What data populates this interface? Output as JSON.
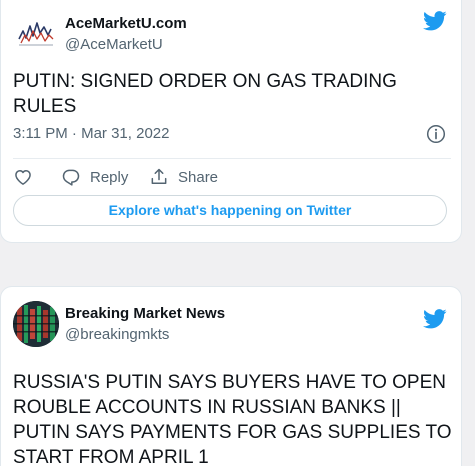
{
  "colors": {
    "twitter_blue": "#1d9bf0",
    "text_primary": "#0f1419",
    "text_secondary": "#536471",
    "background": "#f0f0f2"
  },
  "tweets": [
    {
      "author": {
        "display_name": "AceMarketU.com",
        "handle": "@AceMarketU",
        "avatar": "acemarketu-logo"
      },
      "text": "PUTIN: SIGNED ORDER ON GAS TRADING RULES",
      "timestamp": "3:11 PM · Mar 31, 2022",
      "actions": {
        "reply_label": "Reply",
        "share_label": "Share"
      },
      "explore_label": "Explore what's happening on Twitter",
      "icons": [
        "twitter-bird-icon",
        "info-icon",
        "heart-icon",
        "reply-icon",
        "share-icon"
      ]
    },
    {
      "author": {
        "display_name": "Breaking Market News",
        "handle": "@breakingmkts",
        "avatar": "stock-board-photo"
      },
      "text": "RUSSIA'S PUTIN SAYS BUYERS HAVE TO OPEN ROUBLE ACCOUNTS IN RUSSIAN BANKS || PUTIN SAYS PAYMENTS FOR GAS SUPPLIES TO START FROM APRIL 1",
      "icons": [
        "twitter-bird-icon"
      ]
    }
  ]
}
